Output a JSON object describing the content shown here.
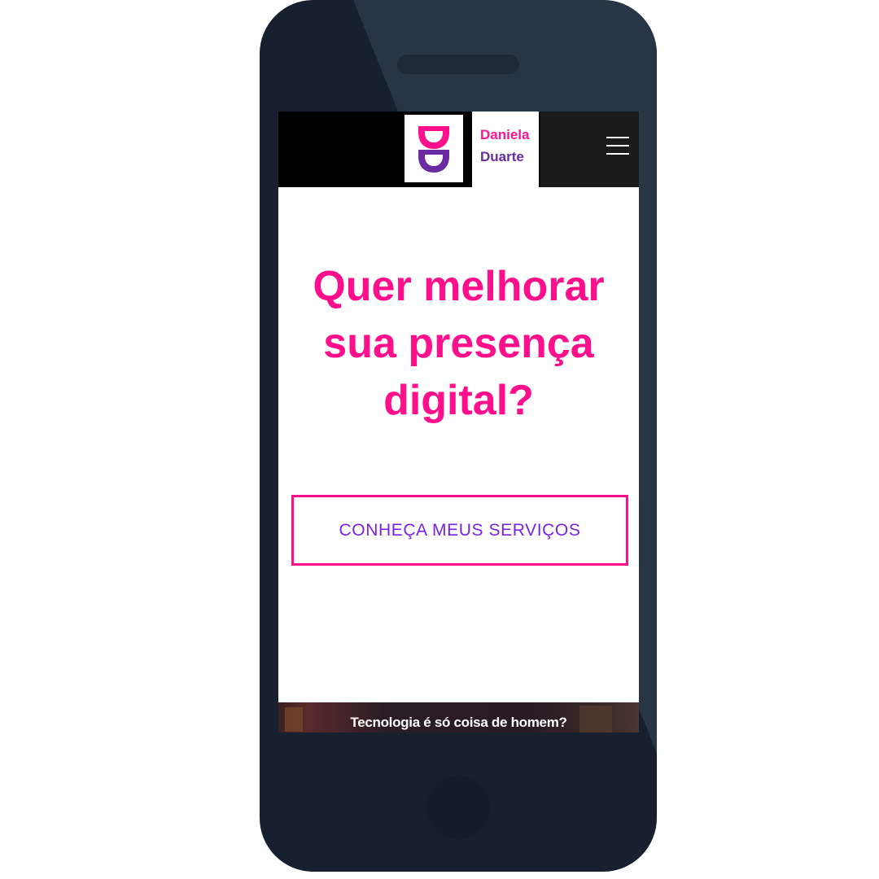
{
  "colors": {
    "phone_body": "#16202e",
    "accent_pink": "#ff0f8c",
    "accent_purple": "#7a22e8",
    "logo_purple": "#6a2aa0",
    "header_bg": "#000000"
  },
  "header": {
    "logo_icon": "dd-monogram-icon",
    "brand_first": "Daniela",
    "brand_last": "Duarte",
    "menu_icon": "hamburger-menu-icon"
  },
  "hero": {
    "title": "Quer melhorar sua presença digital?",
    "cta_label": "CONHEÇA MEUS SERVIÇOS"
  },
  "teaser": {
    "caption": "Tecnologia é só coisa de homem?"
  }
}
